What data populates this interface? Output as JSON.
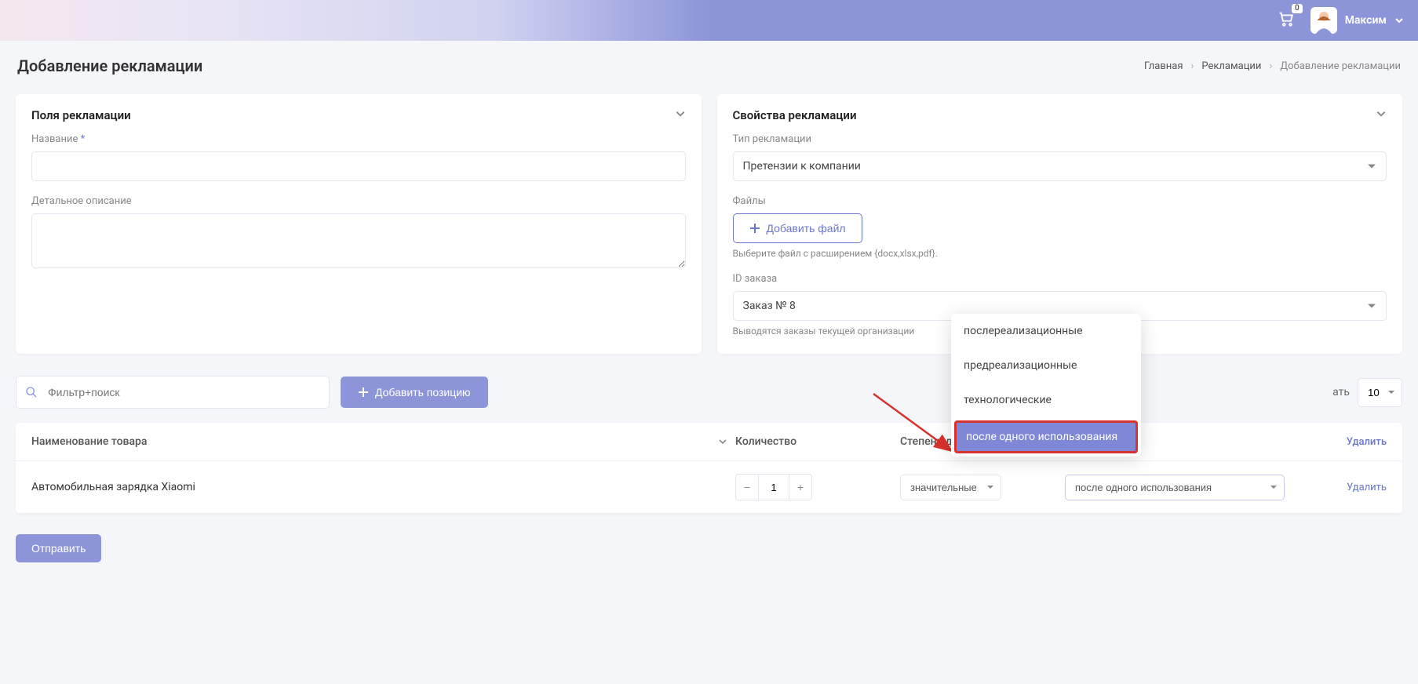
{
  "header": {
    "cart_count": "0",
    "username": "Максим"
  },
  "page": {
    "title": "Добавление рекламации",
    "breadcrumb": [
      "Главная",
      "Рекламации",
      "Добавление рекламации"
    ]
  },
  "left_card": {
    "title": "Поля рекламации",
    "name_label": "Название",
    "name_required": "*",
    "name_value": "",
    "desc_label": "Детальное описание",
    "desc_value": ""
  },
  "right_card": {
    "title": "Свойства рекламации",
    "type_label": "Тип рекламации",
    "type_value": "Претензии к компании",
    "files_label": "Файлы",
    "add_file_label": "Добавить файл",
    "files_hint": "Выберите файл с расширением {docx,xlsx,pdf}.",
    "order_label": "ID заказа",
    "order_value": "Заказ № 8",
    "order_hint": "Выводятся заказы текущей организации"
  },
  "toolbar": {
    "search_placeholder": "Фильтр+поиск",
    "add_position_label": "Добавить позицию",
    "show_label_prefix": "ать",
    "show_value": "10"
  },
  "table": {
    "columns": {
      "name": "Наименование товара",
      "qty": "Количество",
      "defect": "Степень дефекта",
      "delete": "Удалить"
    },
    "rows": [
      {
        "name": "Автомобильная зарядка Xiaomi",
        "qty": "1",
        "defect": "значительные",
        "stage": "после одного использования",
        "delete": "Удалить"
      }
    ]
  },
  "dropdown": {
    "items": [
      "послереализационные",
      "предреализационные",
      "технологические",
      "после одного использования"
    ],
    "selected_index": 3
  },
  "actions": {
    "submit": "Отправить"
  }
}
